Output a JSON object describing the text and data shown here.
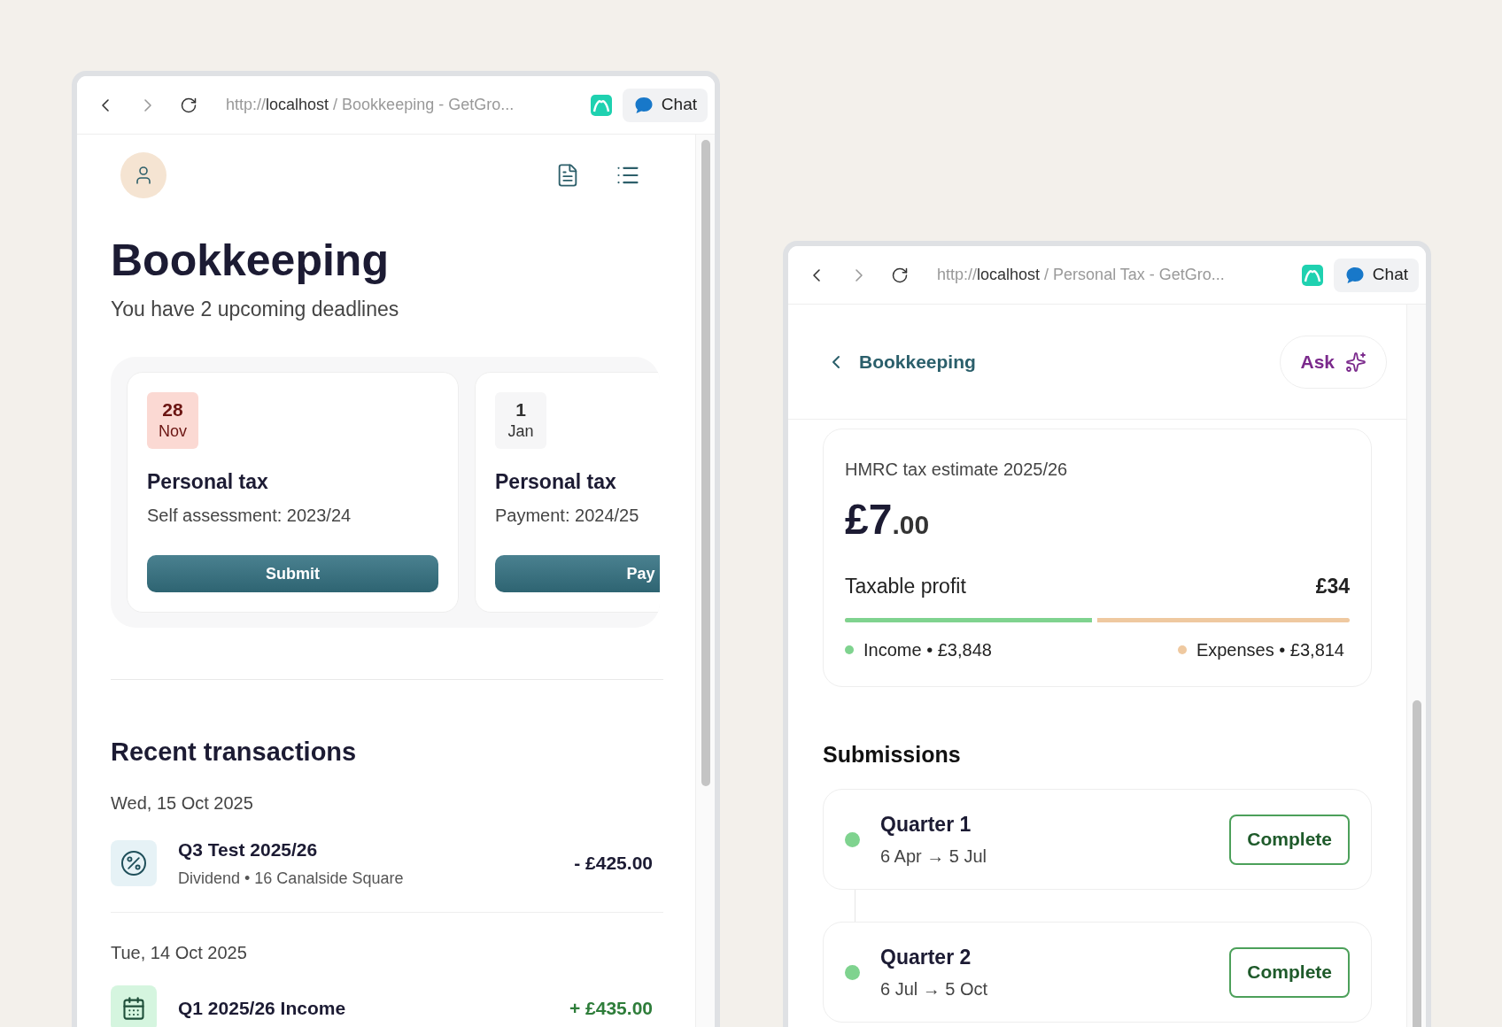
{
  "windows": [
    {
      "browser": {
        "url_scheme": "http://",
        "url_host": "localhost",
        "url_rest": "/ Bookkeeping - GetGro...",
        "chat_label": "Chat"
      },
      "page": {
        "kind": "bookkeeping",
        "title": "Bookkeeping",
        "subtitle": "You have 2 upcoming deadlines",
        "deadlines": [
          {
            "day": "28",
            "month": "Nov",
            "urgent": true,
            "title": "Personal tax",
            "detail": "Self assessment: 2023/24",
            "action": "Submit"
          },
          {
            "day": "1",
            "month": "Jan",
            "urgent": false,
            "title": "Personal tax",
            "detail": "Payment: 2024/25",
            "action": "Pay"
          }
        ],
        "transactions_heading": "Recent transactions",
        "transaction_groups": [
          {
            "date": "Wed, 15 Oct 2025",
            "items": [
              {
                "kind": "percent",
                "title": "Q3 Test 2025/26",
                "detail": "Dividend • 16 Canalside Square",
                "amount": "- £425.00",
                "incoming": false
              }
            ]
          },
          {
            "date": "Tue, 14 Oct 2025",
            "items": [
              {
                "kind": "calendar",
                "title": "Q1 2025/26 Income",
                "amount": "+ £435.00",
                "incoming": true
              }
            ]
          }
        ]
      }
    },
    {
      "browser": {
        "url_scheme": "http://",
        "url_host": "localhost",
        "url_rest": "/ Personal Tax - GetGro...",
        "chat_label": "Chat"
      },
      "page": {
        "kind": "personal_tax",
        "back_label": "Bookkeeping",
        "ask_label": "Ask",
        "estimate": {
          "label": "HMRC tax estimate 2025/26",
          "amount_whole": "£7",
          "amount_pence": ".00",
          "profit_label": "Taxable profit",
          "profit_value": "£34",
          "level": 0.5,
          "income": "Income • £3,848",
          "expenses": "Expenses • £3,814"
        },
        "submissions_heading": "Submissions",
        "submissions": [
          {
            "title": "Quarter 1",
            "period": "6 Apr → 5 Jul",
            "status": "Complete",
            "color": "#7fd38f"
          },
          {
            "title": "Quarter 2",
            "period": "6 Jul → 5 Oct",
            "status": "Complete",
            "color": "#7fd38f"
          }
        ]
      }
    }
  ]
}
